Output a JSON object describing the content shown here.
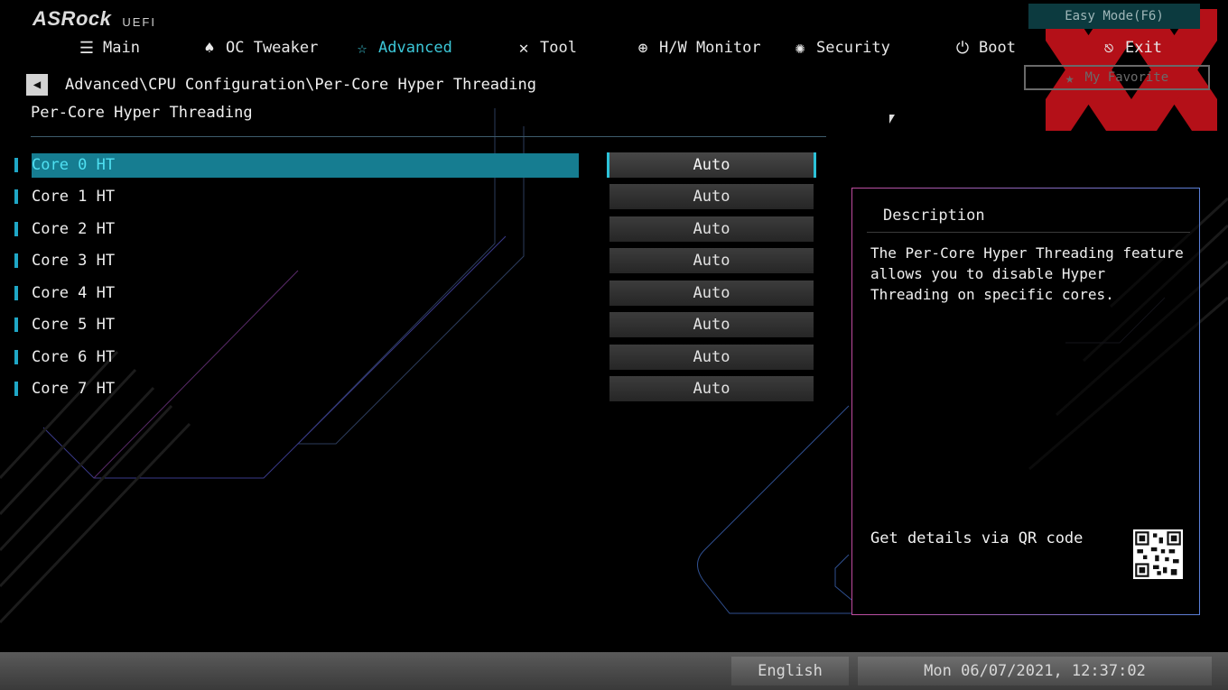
{
  "brand": {
    "logo": "ASRock",
    "sub": "UEFI"
  },
  "easy_mode": "Easy Mode(F6)",
  "favorite": {
    "label": "My Favorite",
    "icon": "star-icon"
  },
  "tabs": [
    {
      "label": "Main",
      "icon": "list-icon"
    },
    {
      "label": "OC Tweaker",
      "icon": "rocket-icon"
    },
    {
      "label": "Advanced",
      "icon": "star-icon"
    },
    {
      "label": "Tool",
      "icon": "tools-icon"
    },
    {
      "label": "H/W Monitor",
      "icon": "crosshair-icon"
    },
    {
      "label": "Security",
      "icon": "shield-icon"
    },
    {
      "label": "Boot",
      "icon": "power-icon"
    },
    {
      "label": "Exit",
      "icon": "exit-icon"
    }
  ],
  "active_tab": "Advanced",
  "breadcrumb": "Advanced\\CPU Configuration\\Per-Core Hyper Threading",
  "page_title": "Per-Core Hyper Threading",
  "settings": [
    {
      "label": "Core 0 HT",
      "value": "Auto",
      "selected": true
    },
    {
      "label": "Core 1 HT",
      "value": "Auto"
    },
    {
      "label": "Core 2 HT",
      "value": "Auto"
    },
    {
      "label": "Core 3 HT",
      "value": "Auto"
    },
    {
      "label": "Core 4 HT",
      "value": "Auto"
    },
    {
      "label": "Core 5 HT",
      "value": "Auto"
    },
    {
      "label": "Core 6 HT",
      "value": "Auto"
    },
    {
      "label": "Core 7 HT",
      "value": "Auto"
    }
  ],
  "description": {
    "title": "Description",
    "text": "The Per-Core Hyper Threading feature allows you to disable Hyper Threading on specific cores.",
    "qr_text": "Get details via QR code"
  },
  "status_bar": {
    "language": "English",
    "datetime": "Mon 06/07/2021, 12:37:02"
  },
  "colors": {
    "accent": "#3cc7d8",
    "selected_row": "#167d91",
    "watermark": "#c8121b"
  }
}
